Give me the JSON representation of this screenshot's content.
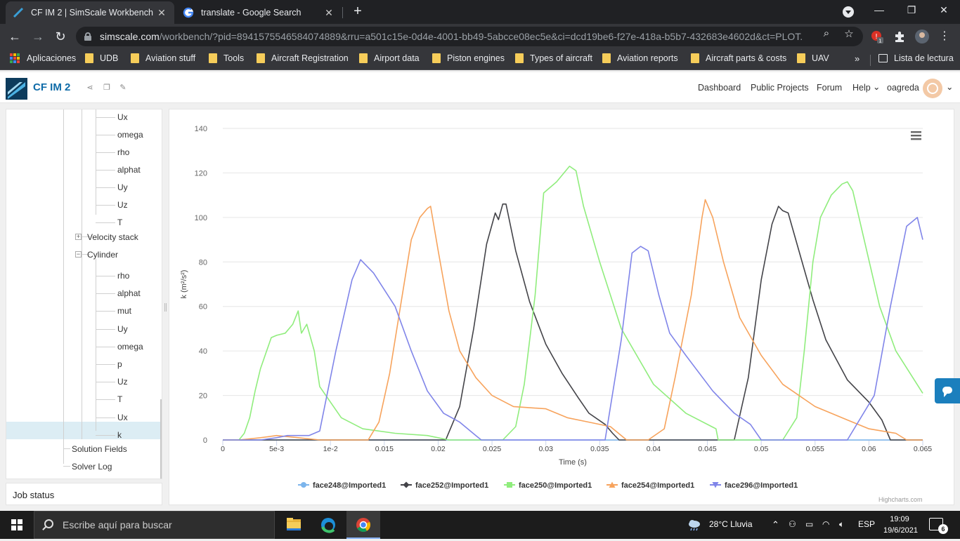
{
  "browser": {
    "tabs": [
      {
        "title": "CF IM 2 | SimScale Workbench",
        "active": true,
        "icon": "simscale-favicon"
      },
      {
        "title": "translate - Google Search",
        "active": false,
        "icon": "google-favicon"
      }
    ],
    "url_host": "simscale.com",
    "url_path": "/workbench/?pid=8941575546584074889&rru=a501c15e-0d4e-4001-bb49-5abcce08ec5e&ci=dcd19be6-f27e-418a-b5b7-432683e4602d&ct=PLOT...",
    "extension_badge": "1",
    "bookmarks": [
      "Aplicaciones",
      "UDB",
      "Aviation stuff",
      "Tools",
      "Aircraft Registration",
      "Airport data",
      "Piston engines",
      "Types of aircraft",
      "Aviation reports",
      "Aircraft parts & costs",
      "UAV"
    ],
    "more_bookmarks": "»",
    "reading_list": "Lista de lectura"
  },
  "app": {
    "project_title": "CF IM 2",
    "nav": [
      "Dashboard",
      "Public Projects",
      "Forum",
      "Help"
    ],
    "username": "oagreda",
    "help_arrow": "⌄"
  },
  "tree": {
    "group1_fields": [
      "Ux",
      "omega",
      "rho",
      "alphat",
      "Uy",
      "Uz",
      "T"
    ],
    "velocity_stack": "Velocity stack",
    "cylinder": "Cylinder",
    "cylinder_fields": [
      "rho",
      "alphat",
      "mut",
      "Uy",
      "omega",
      "p",
      "Uz",
      "T",
      "Ux",
      "k"
    ],
    "selected": "k",
    "solution_fields": "Solution Fields",
    "solver_log": "Solver Log",
    "job_status": "Job status"
  },
  "chart_data": {
    "type": "line",
    "title": "",
    "xlabel": "Time (s)",
    "ylabel": "k (m²/s²)",
    "xlim": [
      0,
      0.065
    ],
    "ylim": [
      0,
      140
    ],
    "x_ticks": [
      0,
      0.005,
      0.01,
      0.015,
      0.02,
      0.025,
      0.03,
      0.035,
      0.04,
      0.045,
      0.05,
      0.055,
      0.06,
      0.065
    ],
    "x_tick_labels": [
      "0",
      "5e-3",
      "1e-2",
      "0.015",
      "0.02",
      "0.025",
      "0.03",
      "0.035",
      "0.04",
      "0.045",
      "0.05",
      "0.055",
      "0.06",
      "0.065"
    ],
    "y_ticks": [
      0,
      20,
      40,
      60,
      80,
      100,
      120,
      140
    ],
    "grid": "horizontal",
    "legend_position": "bottom",
    "credits": "Highcharts.com",
    "series": [
      {
        "name": "face248@Imported1",
        "color": "#7cb5ec",
        "marker": "circle",
        "x": [
          0,
          0.003,
          0.0055,
          0.0075,
          0.009,
          0.065
        ],
        "y": [
          0,
          0,
          0,
          0,
          0,
          0
        ]
      },
      {
        "name": "face252@Imported1",
        "color": "#434348",
        "marker": "diamond",
        "x": [
          0,
          0.0207,
          0.022,
          0.0233,
          0.0245,
          0.0253,
          0.0256,
          0.026,
          0.0263,
          0.0272,
          0.0285,
          0.03,
          0.0315,
          0.033,
          0.034,
          0.0355,
          0.0362,
          0.0368,
          0.0435,
          0.0475,
          0.0488,
          0.05,
          0.051,
          0.0516,
          0.052,
          0.0525,
          0.0535,
          0.0548,
          0.056,
          0.058,
          0.06,
          0.0612,
          0.062,
          0.065
        ],
        "y": [
          0,
          0,
          15,
          50,
          88,
          102,
          99,
          106,
          106,
          85,
          62,
          43,
          30,
          19,
          12,
          7,
          3,
          0,
          0,
          0,
          28,
          72,
          97,
          105,
          103,
          102,
          85,
          63,
          45,
          27,
          17,
          9,
          0,
          0
        ]
      },
      {
        "name": "face250@Imported1",
        "color": "#90ed7d",
        "marker": "square",
        "x": [
          0,
          0.0015,
          0.002,
          0.0025,
          0.003,
          0.0035,
          0.004,
          0.0045,
          0.005,
          0.0058,
          0.0065,
          0.007,
          0.0073,
          0.0078,
          0.0085,
          0.009,
          0.011,
          0.013,
          0.016,
          0.019,
          0.021,
          0.026,
          0.0272,
          0.028,
          0.029,
          0.0298,
          0.031,
          0.0322,
          0.0328,
          0.0335,
          0.035,
          0.037,
          0.04,
          0.043,
          0.0458,
          0.046,
          0.052,
          0.0533,
          0.054,
          0.0548,
          0.0555,
          0.0565,
          0.0575,
          0.058,
          0.0585,
          0.0598,
          0.061,
          0.0625,
          0.065
        ],
        "y": [
          0,
          0,
          3,
          10,
          22,
          32,
          39,
          46,
          47,
          48,
          52,
          58,
          48,
          52,
          40,
          24,
          10,
          5,
          3,
          2,
          0,
          0,
          6,
          25,
          65,
          111,
          116,
          123,
          121,
          105,
          80,
          50,
          25,
          12,
          5,
          0,
          0,
          10,
          40,
          80,
          100,
          110,
          115,
          116,
          112,
          85,
          60,
          40,
          21
        ]
      },
      {
        "name": "face254@Imported1",
        "color": "#f7a35c",
        "marker": "triangle",
        "x": [
          0,
          0.0015,
          0.0035,
          0.005,
          0.007,
          0.009,
          0.0135,
          0.0145,
          0.0155,
          0.0165,
          0.0175,
          0.0183,
          0.019,
          0.0193,
          0.02,
          0.021,
          0.022,
          0.0235,
          0.025,
          0.027,
          0.03,
          0.032,
          0.034,
          0.036,
          0.0375,
          0.0395,
          0.041,
          0.042,
          0.0435,
          0.0445,
          0.0448,
          0.0455,
          0.0465,
          0.048,
          0.05,
          0.052,
          0.055,
          0.058,
          0.06,
          0.0625,
          0.0635,
          0.065
        ],
        "y": [
          0,
          0,
          1,
          2,
          1,
          0,
          0,
          8,
          30,
          60,
          90,
          100,
          104,
          105,
          85,
          58,
          40,
          28,
          20,
          15,
          14,
          10,
          8,
          6,
          0,
          0,
          5,
          28,
          65,
          100,
          108,
          100,
          80,
          55,
          38,
          25,
          15,
          9,
          5,
          3,
          0,
          0
        ]
      },
      {
        "name": "face296@Imported1",
        "color": "#8085e9",
        "marker": "triangle-down",
        "x": [
          0,
          0.0035,
          0.005,
          0.006,
          0.007,
          0.008,
          0.009,
          0.0105,
          0.012,
          0.0128,
          0.014,
          0.016,
          0.0175,
          0.019,
          0.0205,
          0.022,
          0.0235,
          0.024,
          0.0355,
          0.037,
          0.038,
          0.0388,
          0.0395,
          0.0405,
          0.0415,
          0.043,
          0.0455,
          0.0475,
          0.049,
          0.05,
          0.058,
          0.0605,
          0.062,
          0.0635,
          0.0645,
          0.065
        ],
        "y": [
          0,
          0,
          1,
          2,
          2,
          2,
          4,
          40,
          72,
          81,
          75,
          60,
          40,
          22,
          12,
          8,
          2,
          0,
          0,
          45,
          84,
          87,
          85,
          65,
          48,
          38,
          22,
          12,
          7,
          0,
          0,
          20,
          60,
          96,
          100,
          90
        ]
      }
    ]
  },
  "taskbar": {
    "search_placeholder": "Escribe aquí para buscar",
    "weather": "28°C  Lluvia",
    "language": "ESP",
    "time": "19:09",
    "date": "19/6/2021",
    "notif_count": "6"
  }
}
